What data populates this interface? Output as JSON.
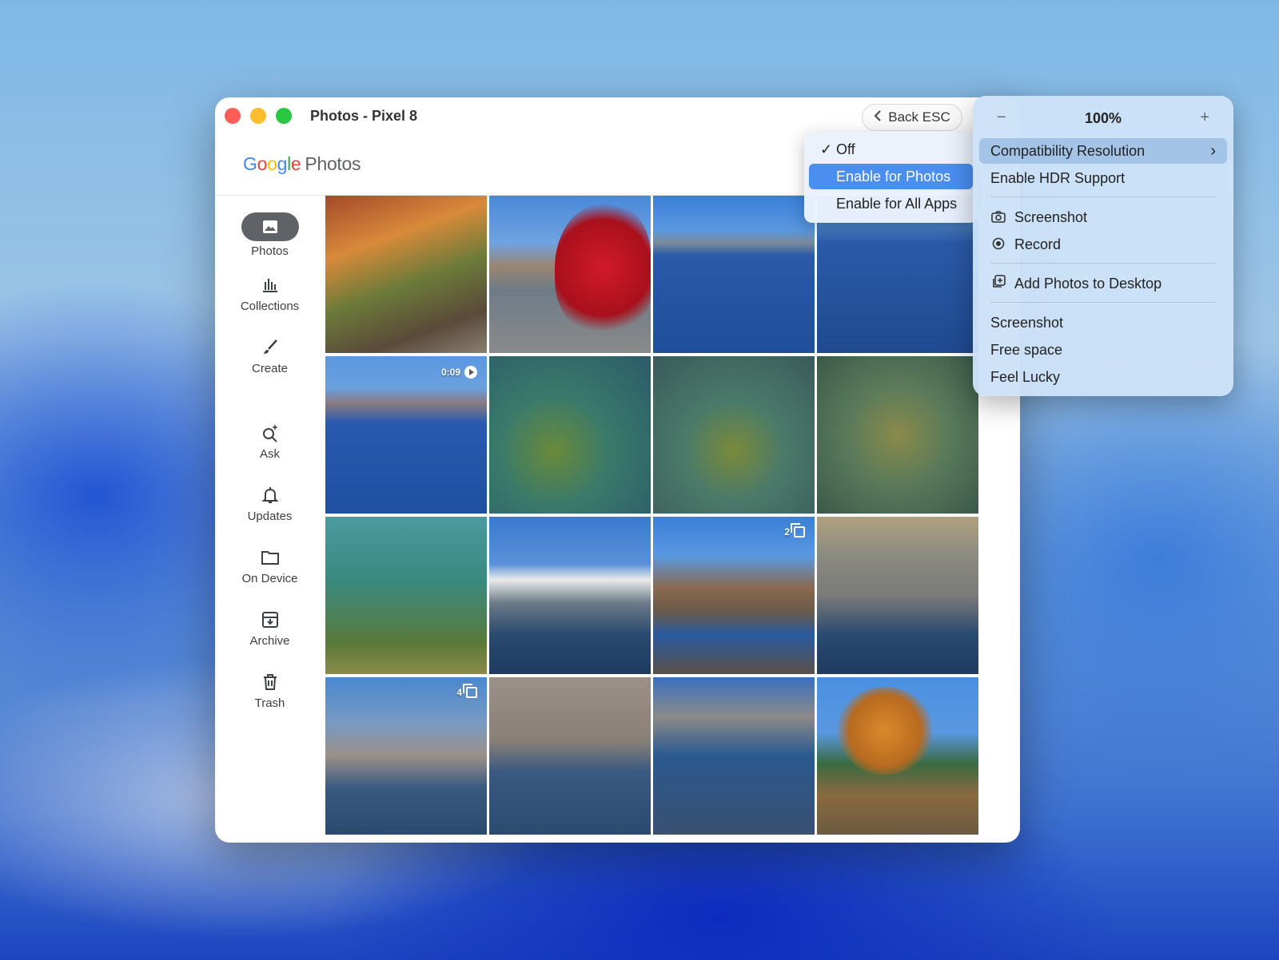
{
  "window": {
    "title": "Photos - Pixel 8",
    "back_label": "Back ESC",
    "logo": {
      "google": [
        "G",
        "o",
        "o",
        "g",
        "l",
        "e"
      ],
      "photos": "Photos"
    }
  },
  "sidebar": {
    "items": [
      {
        "label": "Photos",
        "icon": "photo-icon"
      },
      {
        "label": "Collections",
        "icon": "collections-icon"
      },
      {
        "label": "Create",
        "icon": "brush-icon"
      },
      {
        "label": "Ask",
        "icon": "ask-sparkle-icon"
      },
      {
        "label": "Updates",
        "icon": "bell-icon"
      },
      {
        "label": "On Device",
        "icon": "folder-icon"
      },
      {
        "label": "Archive",
        "icon": "archive-icon"
      },
      {
        "label": "Trash",
        "icon": "trash-icon"
      }
    ]
  },
  "grid": {
    "video_duration": "0:09",
    "stack_counts": [
      "2",
      "4"
    ]
  },
  "dropdown": {
    "items": [
      {
        "label": "Off",
        "checked": true
      },
      {
        "label": "Enable for Photos",
        "selected": true
      },
      {
        "label": "Enable for All Apps"
      }
    ],
    "check_glyph": "✓"
  },
  "context_menu": {
    "zoom": {
      "minus": "−",
      "value": "100%",
      "plus": "+"
    },
    "items": [
      {
        "label": "Compatibility Resolution",
        "submenu": true
      },
      {
        "label": "Enable HDR Support"
      },
      {
        "label": "Screenshot",
        "icon": "camera-icon"
      },
      {
        "label": "Record",
        "icon": "record-icon"
      },
      {
        "label": "Add Photos to Desktop",
        "icon": "add-to-desktop-icon"
      },
      {
        "label": "Screenshot"
      },
      {
        "label": "Free space"
      },
      {
        "label": "Feel Lucky"
      }
    ],
    "chevron": "›"
  },
  "colors": {
    "accent": "#4a8ef0",
    "nav_active": "#5f6368"
  }
}
